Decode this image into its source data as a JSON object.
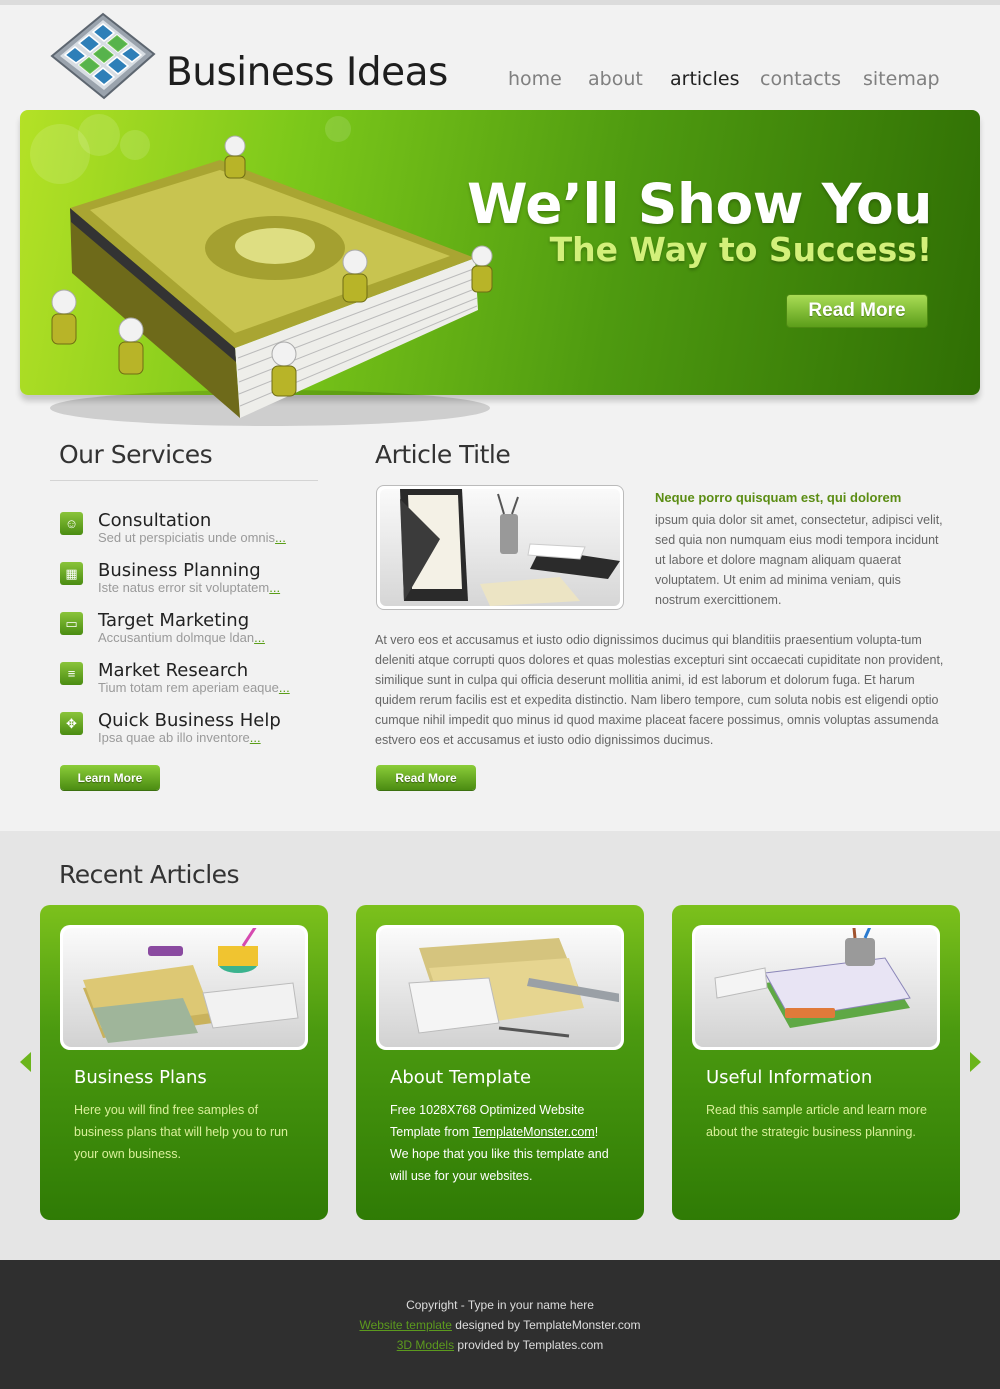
{
  "header": {
    "logo_text": "Business Ideas",
    "nav": [
      {
        "label": "home",
        "active": false
      },
      {
        "label": "about",
        "active": false
      },
      {
        "label": "articles",
        "active": true
      },
      {
        "label": "contacts",
        "active": false
      },
      {
        "label": "sitemap",
        "active": false
      }
    ]
  },
  "banner": {
    "title": "We’ll Show You",
    "subtitle": "The Way to Success!",
    "button": "Read More"
  },
  "services": {
    "title": "Our Services",
    "items": [
      {
        "title": "Consultation",
        "desc": "Sed ut perspiciatis unde omnis",
        "more": "...",
        "icon": "person-icon"
      },
      {
        "title": "Business Planning",
        "desc": "Iste natus error sit voluptatem",
        "more": "...",
        "icon": "calendar-icon"
      },
      {
        "title": "Target Marketing",
        "desc": "Accusantium dolmque ldan",
        "more": "...",
        "icon": "monitor-icon"
      },
      {
        "title": "Market Research",
        "desc": "Tium totam rem aperiam eaque",
        "more": "...",
        "icon": "document-icon"
      },
      {
        "title": "Quick Business Help",
        "desc": "Ipsa quae ab illo inventore",
        "more": "...",
        "icon": "handshake-icon"
      }
    ],
    "button": "Learn More"
  },
  "article": {
    "title": "Article Title",
    "lead_bold": "Neque porro quisquam est, qui dolorem",
    "lead_text": "ipsum quia dolor sit amet, consectetur, adipisci velit, sed quia non numquam eius modi tempora incidunt ut labore et dolore magnam aliquam quaerat voluptatem. Ut enim ad minima veniam, quis nostrum exercittionem.",
    "body": "At vero eos et accusamus et iusto odio dignissimos ducimus qui blanditiis praesentium volupta-tum deleniti atque corrupti quos dolores et quas molestias excepturi sint occaecati cupiditate non provident, similique sunt in culpa qui officia deserunt mollitia animi, id est laborum et dolorum fuga. Et harum quidem rerum facilis est et expedita distinctio. Nam libero tempore, cum soluta nobis est eligendi optio cumque nihil impedit quo minus id quod maxime placeat facere possimus, omnis voluptas assumenda estvero eos et accusamus et iusto odio dignissimos ducimus.",
    "button": "Read More"
  },
  "recent": {
    "title": "Recent Articles",
    "cards": [
      {
        "title": "Business Plans",
        "text": "Here you will find free samples of business plans that will help you to run your own business."
      },
      {
        "title": "About Template",
        "text_before": "Free 1028X768 Optimized Website Template from ",
        "link": "TemplateMonster.com",
        "text_after": "! We hope that you like this template and will use for your websites."
      },
      {
        "title": "Useful Information",
        "text": "Read this sample article and learn more about the strategic business planning."
      }
    ]
  },
  "footer": {
    "copyright": "Copyright - Type in your name here",
    "line2_link": "Website template",
    "line2_text": " designed by TemplateMonster.com",
    "line3_link": "3D Models",
    "line3_text": " provided by Templates.com"
  },
  "colors": {
    "accent_green": "#5a9e18",
    "banner_dark": "#2f6e04",
    "banner_light": "#b4e126",
    "footer_bg": "#2f2f2f"
  }
}
